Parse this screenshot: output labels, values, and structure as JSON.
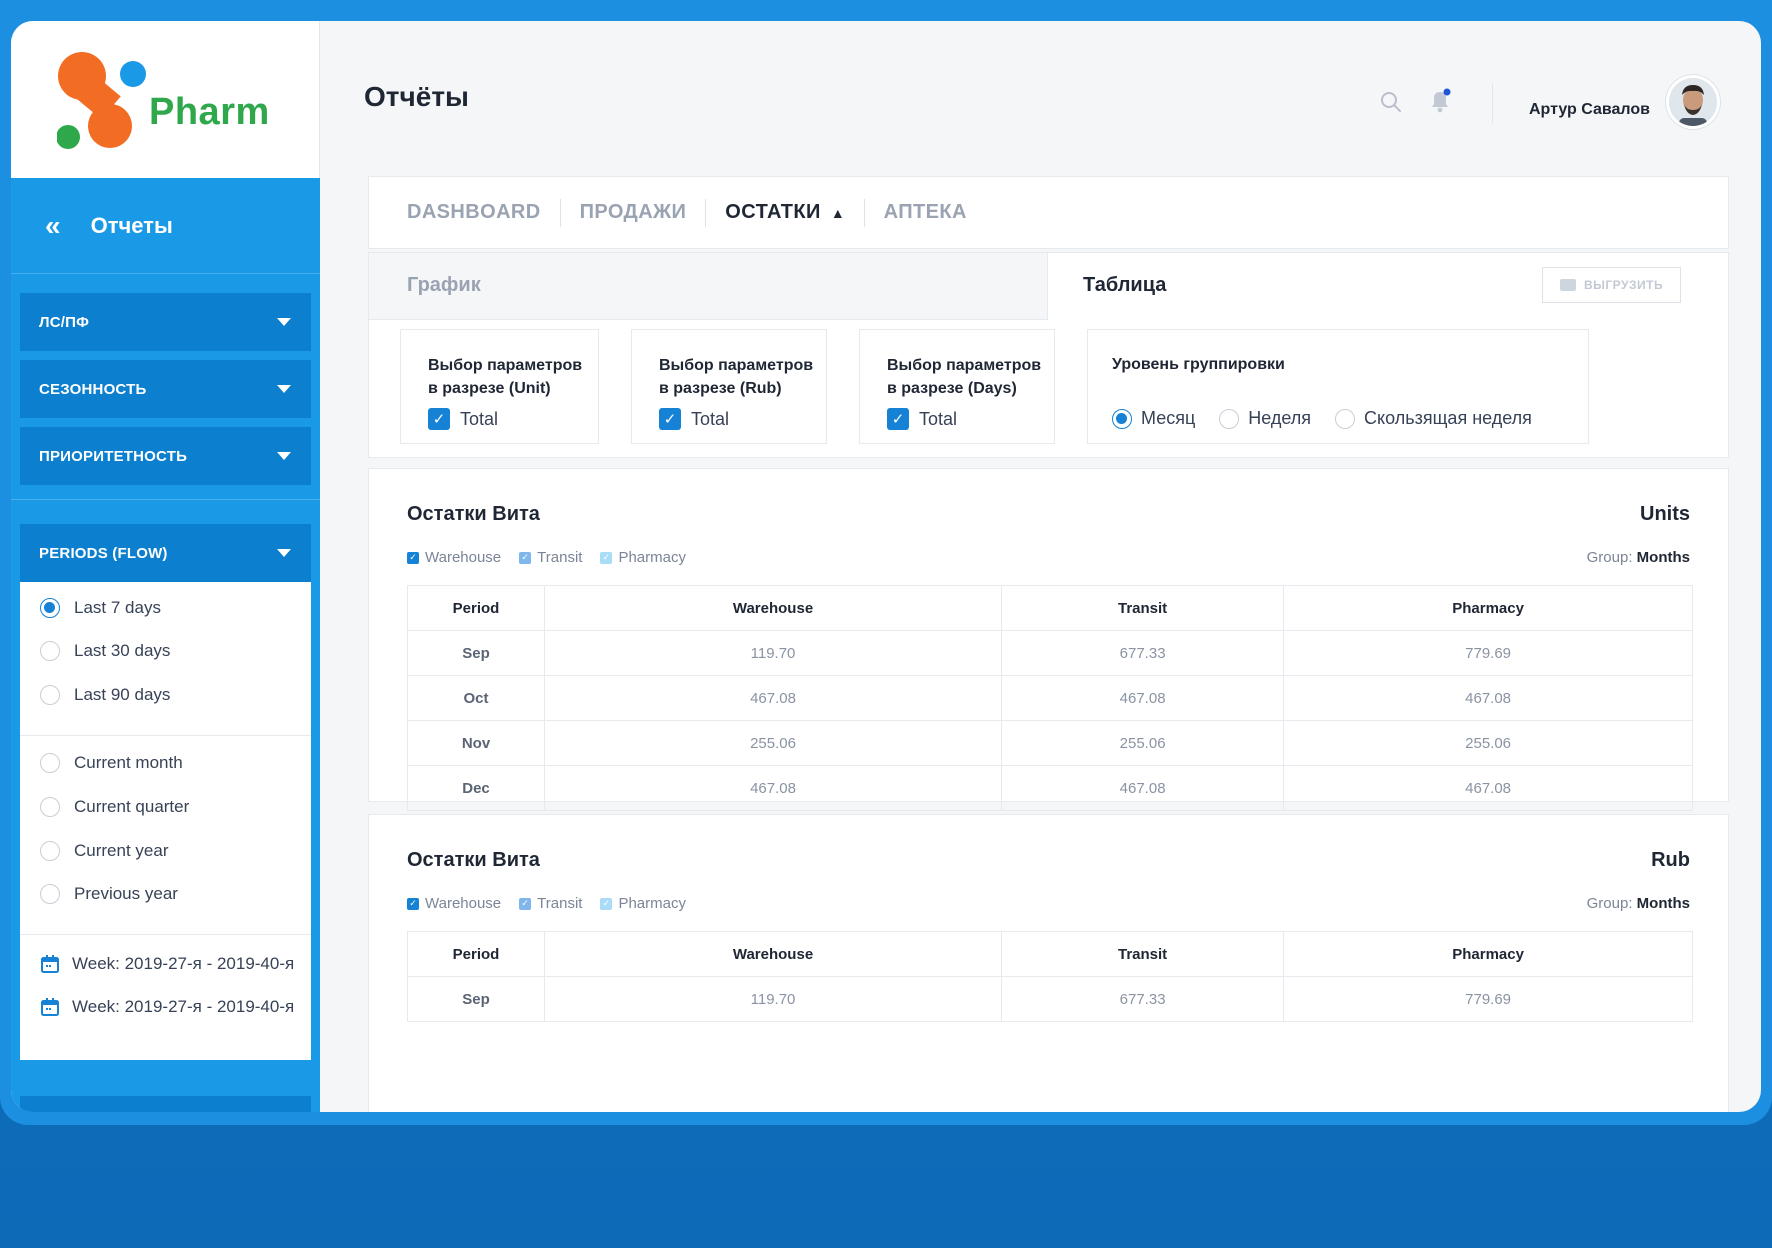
{
  "app": {
    "logo_text": "Pharm"
  },
  "sidebar": {
    "back_title": "Отчеты",
    "menus": [
      {
        "label": "ЛС/ПФ"
      },
      {
        "label": "СЕЗОННОСТЬ"
      },
      {
        "label": "ПРИОРИТЕТНОСТЬ"
      }
    ],
    "periods": {
      "label": "PERIODS (FLOW)",
      "quick": [
        {
          "label": "Last 7 days",
          "selected": true
        },
        {
          "label": "Last 30 days",
          "selected": false
        },
        {
          "label": "Last 90 days",
          "selected": false
        }
      ],
      "calendar": [
        {
          "label": "Current month",
          "selected": false
        },
        {
          "label": "Current quarter",
          "selected": false
        },
        {
          "label": "Current year",
          "selected": false
        },
        {
          "label": "Previous year",
          "selected": false
        }
      ],
      "weeks": [
        {
          "label": "Week: 2019-27-я - 2019-40-я"
        },
        {
          "label": "Week: 2019-27-я - 2019-40-я"
        }
      ]
    }
  },
  "header": {
    "title": "Отчёты",
    "user_name": "Артур Савалов",
    "search_icon": "search-icon",
    "bell_icon": "bell-icon",
    "accent": "#1582d6"
  },
  "tabs": [
    {
      "label": "DASHBOARD",
      "active": false
    },
    {
      "label": "ПРОДАЖИ",
      "active": false
    },
    {
      "label": "ОСТАТКИ",
      "active": true
    },
    {
      "label": "АПТЕКА",
      "active": false
    }
  ],
  "view": {
    "chart_label": "График",
    "table_label": "Таблица",
    "export_label": "ВЫГРУЗИТЬ"
  },
  "params": [
    {
      "title_line1": "Выбор параметров",
      "title_line2": "в разрезе (Unit)",
      "check_label": "Total"
    },
    {
      "title_line1": "Выбор параметров",
      "title_line2": "в разрезе (Rub)",
      "check_label": "Total"
    },
    {
      "title_line1": "Выбор параметров",
      "title_line2": "в разрезе (Days)",
      "check_label": "Total"
    }
  ],
  "grouping": {
    "title": "Уровень группировки",
    "options": [
      {
        "label": "Месяц",
        "selected": true
      },
      {
        "label": "Неделя",
        "selected": false
      },
      {
        "label": "Скользящая неделя",
        "selected": false
      }
    ]
  },
  "tables": [
    {
      "title": "Остатки Вита",
      "unit": "Units",
      "legend": [
        "Warehouse",
        "Transit",
        "Pharmacy"
      ],
      "group_prefix": "Group:",
      "group_value": "Months",
      "columns": [
        "Period",
        "Warehouse",
        "Transit",
        "Pharmacy"
      ],
      "rows": [
        [
          "Sep",
          "119.70",
          "677.33",
          "779.69"
        ],
        [
          "Oct",
          "467.08",
          "467.08",
          "467.08"
        ],
        [
          "Nov",
          "255.06",
          "255.06",
          "255.06"
        ],
        [
          "Dec",
          "467.08",
          "467.08",
          "467.08"
        ]
      ]
    },
    {
      "title": "Остатки Вита",
      "unit": "Rub",
      "legend": [
        "Warehouse",
        "Transit",
        "Pharmacy"
      ],
      "group_prefix": "Group:",
      "group_value": "Months",
      "columns": [
        "Period",
        "Warehouse",
        "Transit",
        "Pharmacy"
      ],
      "rows": [
        [
          "Sep",
          "119.70",
          "677.33",
          "779.69"
        ]
      ]
    }
  ],
  "legend_colors": {
    "Warehouse": "#1582d6",
    "Transit": "#7fb6ec",
    "Pharmacy": "#a9dcf7"
  }
}
